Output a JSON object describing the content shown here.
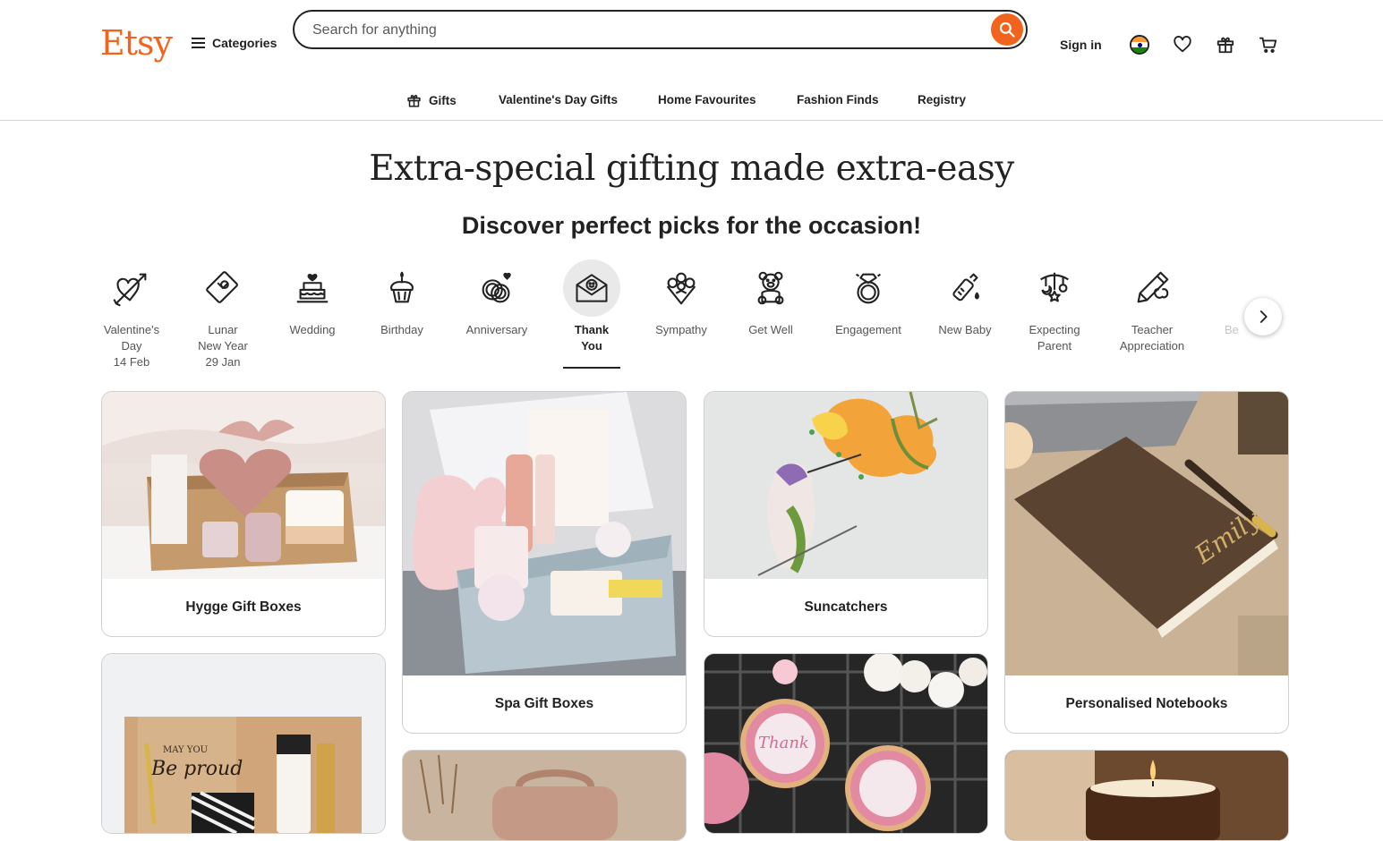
{
  "header": {
    "logo": "Etsy",
    "categories_label": "Categories",
    "search_placeholder": "Search for anything",
    "signin_label": "Sign in"
  },
  "subnav": [
    {
      "label": "Gifts",
      "icon": "gift-icon"
    },
    {
      "label": "Valentine's Day Gifts"
    },
    {
      "label": "Home Favourites"
    },
    {
      "label": "Fashion Finds"
    },
    {
      "label": "Registry"
    }
  ],
  "headline": "Extra-special gifting made extra-easy",
  "subheadline": "Discover perfect picks for the occasion!",
  "occasions": [
    {
      "lines": [
        "Valentine's",
        "Day",
        "14 Feb"
      ],
      "icon": "heart-arrow-icon"
    },
    {
      "lines": [
        "Lunar",
        "New Year",
        "29 Jan"
      ],
      "icon": "red-envelope-icon"
    },
    {
      "lines": [
        "Wedding"
      ],
      "icon": "wedding-cake-icon"
    },
    {
      "lines": [
        "Birthday"
      ],
      "icon": "cupcake-icon"
    },
    {
      "lines": [
        "Anniversary"
      ],
      "icon": "rings-icon"
    },
    {
      "lines": [
        "Thank",
        "You"
      ],
      "icon": "thank-you-envelope-icon",
      "active": true
    },
    {
      "lines": [
        "Sympathy"
      ],
      "icon": "bouquet-icon"
    },
    {
      "lines": [
        "Get Well"
      ],
      "icon": "teddy-bear-icon"
    },
    {
      "lines": [
        "Engagement"
      ],
      "icon": "diamond-ring-icon"
    },
    {
      "lines": [
        "New Baby"
      ],
      "icon": "baby-bottle-icon"
    },
    {
      "lines": [
        "Expecting",
        "Parent"
      ],
      "icon": "baby-mobile-icon"
    },
    {
      "lines": [
        "Teacher",
        "Appreciation"
      ],
      "icon": "pencil-apple-icon"
    },
    {
      "lines": [
        "Be"
      ],
      "icon": "partial-icon"
    }
  ],
  "cards": [
    {
      "caption": "Hygge Gift Boxes"
    },
    {
      "caption": "Spa Gift Boxes"
    },
    {
      "caption": "Suncatchers"
    },
    {
      "caption": "Personalised Notebooks"
    }
  ],
  "colors": {
    "brand": "#f1641e",
    "text": "#222222"
  }
}
